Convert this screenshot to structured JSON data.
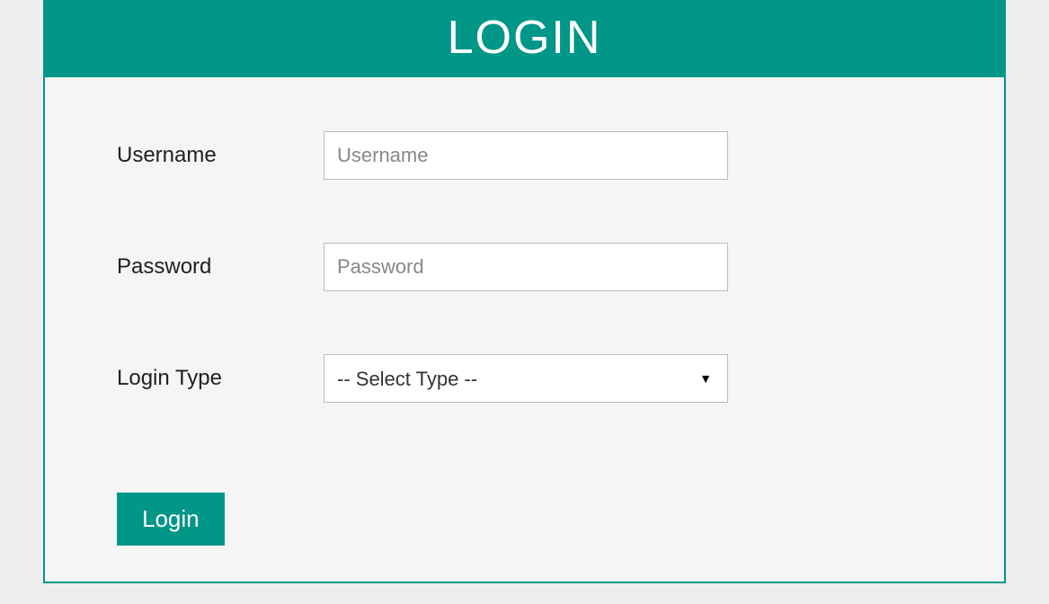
{
  "header": {
    "title": "LOGIN"
  },
  "form": {
    "username": {
      "label": "Username",
      "placeholder": "Username",
      "value": ""
    },
    "password": {
      "label": "Password",
      "placeholder": "Password",
      "value": ""
    },
    "login_type": {
      "label": "Login Type",
      "selected": "-- Select Type --"
    },
    "submit_label": "Login"
  },
  "colors": {
    "primary": "#009688",
    "background": "#eeeeee",
    "panel_bg": "#f5f5f5"
  }
}
